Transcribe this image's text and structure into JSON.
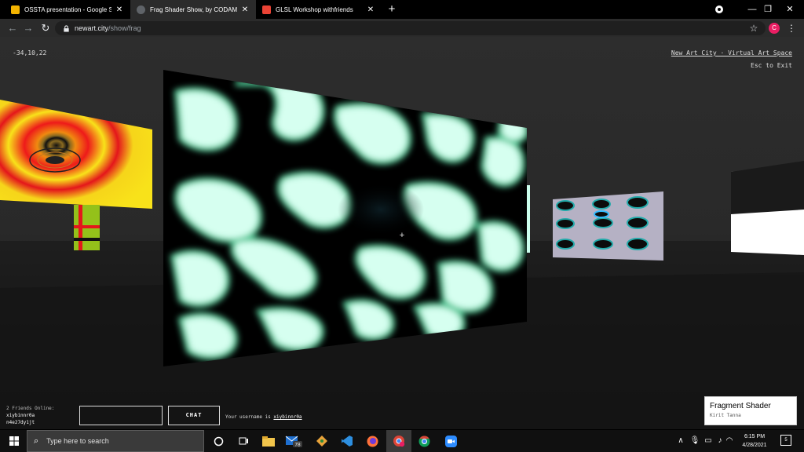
{
  "browser": {
    "tabs": [
      {
        "title": "OSSTA presentation - Google Sli",
        "favicon_color": "#f4b400",
        "active": false
      },
      {
        "title": "Frag Shader Show, by CODAME",
        "favicon_color": "#5f6368",
        "active": true
      },
      {
        "title": "GLSL Workshop withfriends",
        "favicon_color": "#ea4335",
        "active": false
      }
    ],
    "new_tab_icon": "plus-icon",
    "url_host": "newart.city",
    "url_path": "/show/frag",
    "profile_initial": "C",
    "window_controls": {
      "minimize": "—",
      "restore": "❐",
      "close": "✕"
    }
  },
  "scene": {
    "coordinates": "-34,10,22",
    "site_link": "New Art City · Virtual Art Space",
    "exit_hint": "Esc to Exit",
    "crosshair": "+"
  },
  "hud": {
    "friends_online": "2 Friends Online:",
    "friends": [
      "xiybinnr0a",
      "n4e27dy1jt"
    ],
    "chat_button": "CHAT",
    "username_prefix": "Your username is ",
    "username": "xiybinnr0a"
  },
  "artwork_card": {
    "title": "Fragment Shader",
    "artist": "Kirit Tanna"
  },
  "taskbar": {
    "search_placeholder": "Type here to search",
    "mail_badge": "78",
    "time": "6:15 PM",
    "date": "4/28/2021",
    "notification_count": "5"
  },
  "colors": {
    "shader_glow": "#8ef0c8",
    "panel_red": "#e4161b",
    "panel_yellow": "#f8e21a",
    "avatar_pink": "#e91e63"
  }
}
